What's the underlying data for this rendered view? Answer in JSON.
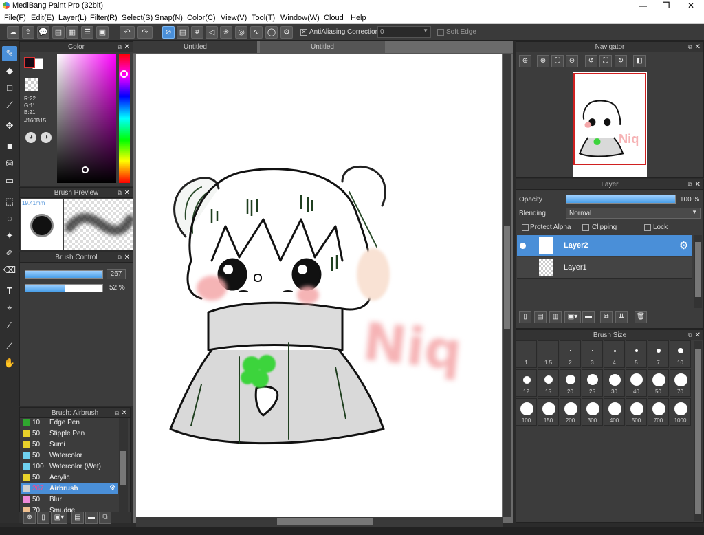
{
  "window": {
    "title": "MediBang Paint Pro (32bit)",
    "min": "—",
    "restore": "❐",
    "close": "✕"
  },
  "menu": [
    "File(F)",
    "Edit(E)",
    "Layer(L)",
    "Filter(R)",
    "Select(S)",
    "Snap(N)",
    "Color(C)",
    "View(V)",
    "Tool(T)",
    "Window(W)",
    "Cloud",
    "Help"
  ],
  "toolbar": {
    "antialiasing_label": "AntiAliasing",
    "correction_label": "Correction",
    "correction_value": "0",
    "softedge_label": "Soft Edge"
  },
  "tabs": [
    "Untitled",
    "Untitled"
  ],
  "color_panel": {
    "title": "Color",
    "r": "R:22",
    "g": "G:11",
    "b": "B:21",
    "hex": "#160B15",
    "fg": "#160b15",
    "bg": "#ffffff"
  },
  "brush_preview": {
    "title": "Brush Preview",
    "size": "19.41mm"
  },
  "brush_control": {
    "title": "Brush Control",
    "size_value": "267",
    "opacity_value": "52 %",
    "size_fraction": 1.0,
    "opacity_fraction": 0.52
  },
  "brush_list": {
    "title": "Brush: Airbrush",
    "items": [
      {
        "n": "10",
        "name": "Edge Pen",
        "color": "#2fa82f"
      },
      {
        "n": "50",
        "name": "Stipple Pen",
        "color": "#e8d22a"
      },
      {
        "n": "50",
        "name": "Sumi",
        "color": "#e8d22a"
      },
      {
        "n": "50",
        "name": "Watercolor",
        "color": "#6fd2f0"
      },
      {
        "n": "100",
        "name": "Watercolor (Wet)",
        "color": "#6fd2f0"
      },
      {
        "n": "50",
        "name": "Acrylic",
        "color": "#e8d22a"
      },
      {
        "n": "267",
        "name": "Airbrush",
        "color": "#d0d0d0"
      },
      {
        "n": "50",
        "name": "Blur",
        "color": "#f08ad8"
      },
      {
        "n": "70",
        "name": "Smudge",
        "color": "#f0c090"
      }
    ],
    "selected_index": 6
  },
  "navigator": {
    "title": "Navigator"
  },
  "layer_panel": {
    "title": "Layer",
    "opacity_label": "Opacity",
    "opacity_value": "100 %",
    "opacity_fraction": 1.0,
    "blending_label": "Blending",
    "blending_value": "Normal",
    "protect_alpha": "Protect Alpha",
    "clipping": "Clipping",
    "lock": "Lock",
    "layers": [
      {
        "name": "Layer2",
        "selected": true
      },
      {
        "name": "Layer1",
        "selected": false
      }
    ]
  },
  "brush_size": {
    "title": "Brush Size",
    "sizes": [
      "1",
      "1.5",
      "2",
      "3",
      "4",
      "5",
      "7",
      "10",
      "12",
      "15",
      "20",
      "25",
      "30",
      "40",
      "50",
      "70",
      "100",
      "150",
      "200",
      "300",
      "400",
      "500",
      "700",
      "1000"
    ]
  },
  "canvas": {
    "signature": "Niq"
  }
}
